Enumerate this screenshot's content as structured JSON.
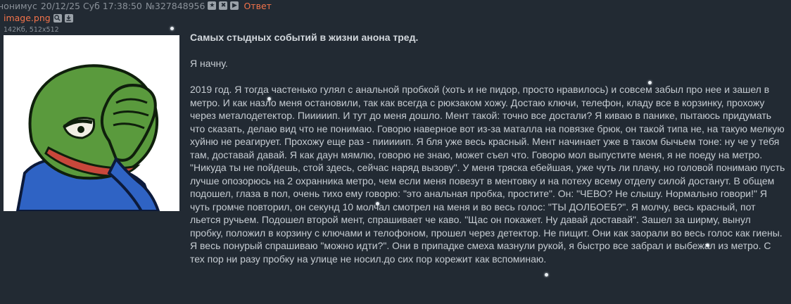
{
  "header": {
    "name": "нонимус",
    "datetime": "20/12/25 Суб 17:38:50",
    "post_number": "№327848956",
    "btn_star": "★",
    "btn_close": "✖",
    "btn_play": "▶",
    "reply_label": "Ответ"
  },
  "file": {
    "name": "image.png",
    "meta": "142Кб, 512x512",
    "icon_search": "search-icon",
    "icon_download": "download-icon"
  },
  "post": {
    "title": "Самых стыдных событий в жизни анона тред.",
    "intro": "Я начну.",
    "body": "2019 год. Я тогда частенько гулял с анальной пробкой (хоть и не пидор, просто нравилось) и совсем забыл про нее и зашел в метро. И как назло меня остановили, так как всегда с рюкзаком хожу. Достаю ключи, телефон, кладу все в корзинку, прохожу через металодетектор. Пииииип. И тут до меня дошло. Мент такой: точно все достали? Я киваю в панике, пытаюсь придумать что сказать, делаю вид что не понимаю. Говорю наверное вот из-за маталла на повязке брюк, он такой типа не, на такую мелкую хуйню не реагирует. Прохожу еще раз - пииииип. Я бля уже весь красный. Мент начинает уже в таком бычьем тоне: ну че у тебя там, доставай давай. Я как даун мямлю, говорю не знаю, может съел что. Говорю мол выпустите меня, я не поеду на метро. \"Никуда ты не пойдешь, стой здесь, сейчас наряд вызову\". У меня тряска ебейшая, уже чуть ли плачу, но головой понимаю пусть лучше опозорюсь на 2 охранника метро, чем если меня повезут в ментовку и на потеху всему отделу силой достанут. В общем подошел, глаза в пол, очень тихо ему говорю: \"это анальная пробка, простите\". Он: \"ЧЕВО? Не слышу. Нормально говори!\" Я чуть громче повторил, он секунд 10 молчал смотрел на меня и во весь голос: \"ТЫ ДОЛБОЕБ?\". Я молчу, весь красный, пот льется ручьем. Подошел второй мент, спрашивает че каво. \"Щас он покажет. Ну давай доставай\". Зашел за ширму, вынул пробку, положил в корзину с ключами и телофоном, прошел через детектор. Не пищит. Они как заорали во весь голос как гиены. Я весь понурый спрашиваю \"можно идти?\". Они в припадке смеха мазнули рукой, я быстро все забрал и выбежал из метро. С тех пор ни разу пробку на улице не носил.до сих пор корежит как вспоминаю."
  },
  "colors": {
    "background": "#222a33",
    "text": "#c6ccd2",
    "link": "#f3734a",
    "muted": "#8a9199"
  }
}
